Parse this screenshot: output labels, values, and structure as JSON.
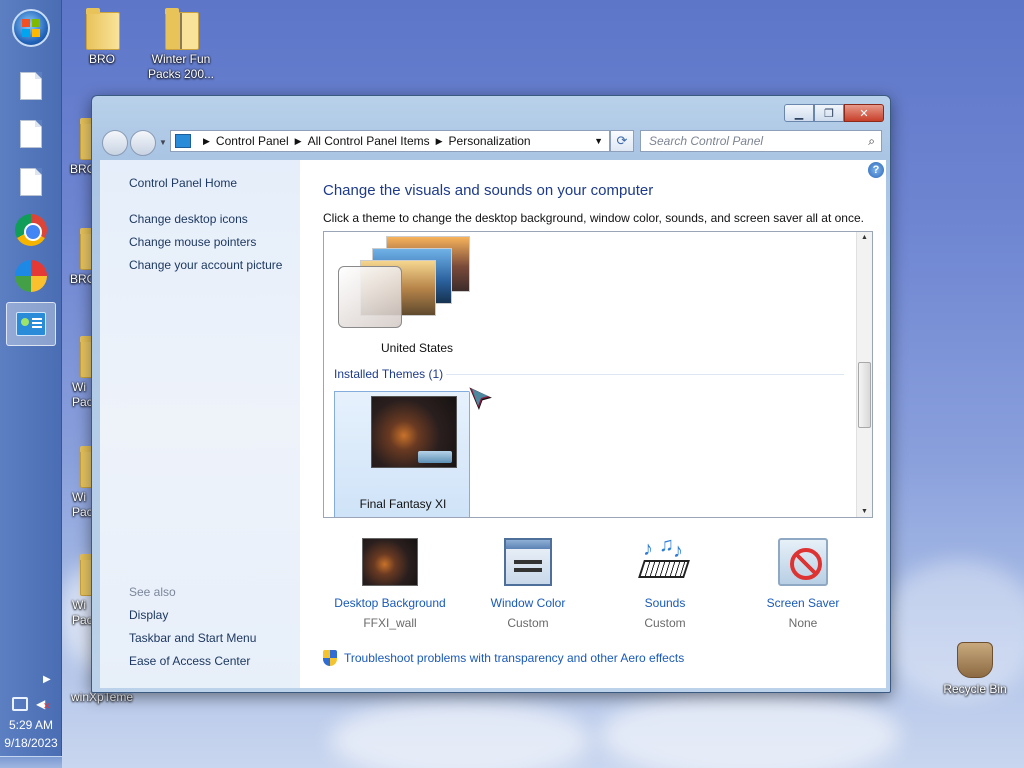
{
  "desktop": {
    "icons": [
      {
        "label": "BRO"
      },
      {
        "label": "Winter Fun Packs 200..."
      },
      {
        "label": "BRO"
      },
      {
        "label": "BRO"
      },
      {
        "label": "Wi Pac"
      },
      {
        "label": "Wi Pac"
      },
      {
        "label": "Wi Pac"
      },
      {
        "label": "winXpTeme"
      },
      {
        "label": "Recycle Bin"
      }
    ]
  },
  "taskbar": {
    "clock_time": "5:29 AM",
    "clock_date": "9/18/2023"
  },
  "window": {
    "breadcrumb": [
      "Control Panel",
      "All Control Panel Items",
      "Personalization"
    ],
    "search_placeholder": "Search Control Panel",
    "left_pane": {
      "home": "Control Panel Home",
      "links": [
        "Change desktop icons",
        "Change mouse pointers",
        "Change your account picture"
      ],
      "see_also_label": "See also",
      "see_also": [
        "Display",
        "Taskbar and Start Menu",
        "Ease of Access Center"
      ]
    },
    "heading": "Change the visuals and sounds on your computer",
    "subheading": "Click a theme to change the desktop background, window color, sounds, and screen saver all at once.",
    "themes": {
      "top_theme_label": "United States",
      "installed_group_label": "Installed Themes (1)",
      "installed": [
        {
          "label": "Final Fantasy XI",
          "selected": true
        }
      ]
    },
    "bottom_settings": [
      {
        "title": "Desktop Background",
        "value": "FFXI_wall"
      },
      {
        "title": "Window Color",
        "value": "Custom"
      },
      {
        "title": "Sounds",
        "value": "Custom"
      },
      {
        "title": "Screen Saver",
        "value": "None"
      }
    ],
    "troubleshoot_link": "Troubleshoot problems with transparency and other Aero effects",
    "help_glyph": "?"
  }
}
